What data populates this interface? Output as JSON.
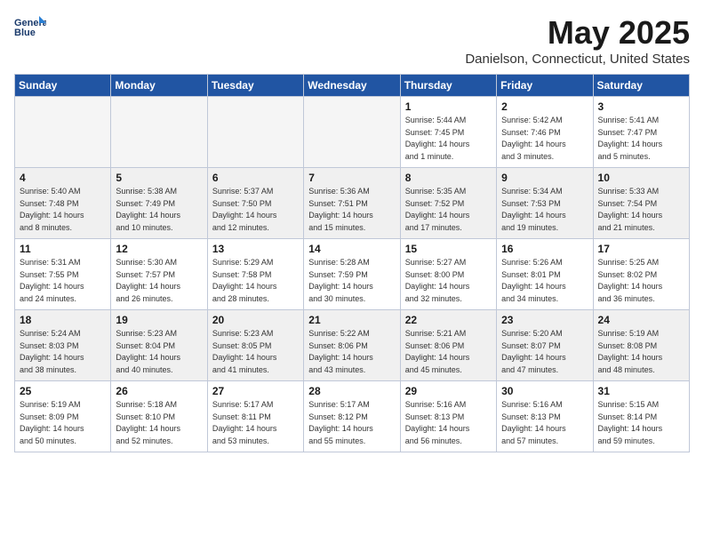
{
  "logo": {
    "line1": "General",
    "line2": "Blue"
  },
  "title": "May 2025",
  "subtitle": "Danielson, Connecticut, United States",
  "days_of_week": [
    "Sunday",
    "Monday",
    "Tuesday",
    "Wednesday",
    "Thursday",
    "Friday",
    "Saturday"
  ],
  "weeks": [
    [
      {
        "day": "",
        "info": "",
        "empty": true
      },
      {
        "day": "",
        "info": "",
        "empty": true
      },
      {
        "day": "",
        "info": "",
        "empty": true
      },
      {
        "day": "",
        "info": "",
        "empty": true
      },
      {
        "day": "1",
        "info": "Sunrise: 5:44 AM\nSunset: 7:45 PM\nDaylight: 14 hours\nand 1 minute."
      },
      {
        "day": "2",
        "info": "Sunrise: 5:42 AM\nSunset: 7:46 PM\nDaylight: 14 hours\nand 3 minutes."
      },
      {
        "day": "3",
        "info": "Sunrise: 5:41 AM\nSunset: 7:47 PM\nDaylight: 14 hours\nand 5 minutes."
      }
    ],
    [
      {
        "day": "4",
        "info": "Sunrise: 5:40 AM\nSunset: 7:48 PM\nDaylight: 14 hours\nand 8 minutes.",
        "shaded": true
      },
      {
        "day": "5",
        "info": "Sunrise: 5:38 AM\nSunset: 7:49 PM\nDaylight: 14 hours\nand 10 minutes.",
        "shaded": true
      },
      {
        "day": "6",
        "info": "Sunrise: 5:37 AM\nSunset: 7:50 PM\nDaylight: 14 hours\nand 12 minutes.",
        "shaded": true
      },
      {
        "day": "7",
        "info": "Sunrise: 5:36 AM\nSunset: 7:51 PM\nDaylight: 14 hours\nand 15 minutes.",
        "shaded": true
      },
      {
        "day": "8",
        "info": "Sunrise: 5:35 AM\nSunset: 7:52 PM\nDaylight: 14 hours\nand 17 minutes.",
        "shaded": true
      },
      {
        "day": "9",
        "info": "Sunrise: 5:34 AM\nSunset: 7:53 PM\nDaylight: 14 hours\nand 19 minutes.",
        "shaded": true
      },
      {
        "day": "10",
        "info": "Sunrise: 5:33 AM\nSunset: 7:54 PM\nDaylight: 14 hours\nand 21 minutes.",
        "shaded": true
      }
    ],
    [
      {
        "day": "11",
        "info": "Sunrise: 5:31 AM\nSunset: 7:55 PM\nDaylight: 14 hours\nand 24 minutes."
      },
      {
        "day": "12",
        "info": "Sunrise: 5:30 AM\nSunset: 7:57 PM\nDaylight: 14 hours\nand 26 minutes."
      },
      {
        "day": "13",
        "info": "Sunrise: 5:29 AM\nSunset: 7:58 PM\nDaylight: 14 hours\nand 28 minutes."
      },
      {
        "day": "14",
        "info": "Sunrise: 5:28 AM\nSunset: 7:59 PM\nDaylight: 14 hours\nand 30 minutes."
      },
      {
        "day": "15",
        "info": "Sunrise: 5:27 AM\nSunset: 8:00 PM\nDaylight: 14 hours\nand 32 minutes."
      },
      {
        "day": "16",
        "info": "Sunrise: 5:26 AM\nSunset: 8:01 PM\nDaylight: 14 hours\nand 34 minutes."
      },
      {
        "day": "17",
        "info": "Sunrise: 5:25 AM\nSunset: 8:02 PM\nDaylight: 14 hours\nand 36 minutes."
      }
    ],
    [
      {
        "day": "18",
        "info": "Sunrise: 5:24 AM\nSunset: 8:03 PM\nDaylight: 14 hours\nand 38 minutes.",
        "shaded": true
      },
      {
        "day": "19",
        "info": "Sunrise: 5:23 AM\nSunset: 8:04 PM\nDaylight: 14 hours\nand 40 minutes.",
        "shaded": true
      },
      {
        "day": "20",
        "info": "Sunrise: 5:23 AM\nSunset: 8:05 PM\nDaylight: 14 hours\nand 41 minutes.",
        "shaded": true
      },
      {
        "day": "21",
        "info": "Sunrise: 5:22 AM\nSunset: 8:06 PM\nDaylight: 14 hours\nand 43 minutes.",
        "shaded": true
      },
      {
        "day": "22",
        "info": "Sunrise: 5:21 AM\nSunset: 8:06 PM\nDaylight: 14 hours\nand 45 minutes.",
        "shaded": true
      },
      {
        "day": "23",
        "info": "Sunrise: 5:20 AM\nSunset: 8:07 PM\nDaylight: 14 hours\nand 47 minutes.",
        "shaded": true
      },
      {
        "day": "24",
        "info": "Sunrise: 5:19 AM\nSunset: 8:08 PM\nDaylight: 14 hours\nand 48 minutes.",
        "shaded": true
      }
    ],
    [
      {
        "day": "25",
        "info": "Sunrise: 5:19 AM\nSunset: 8:09 PM\nDaylight: 14 hours\nand 50 minutes."
      },
      {
        "day": "26",
        "info": "Sunrise: 5:18 AM\nSunset: 8:10 PM\nDaylight: 14 hours\nand 52 minutes."
      },
      {
        "day": "27",
        "info": "Sunrise: 5:17 AM\nSunset: 8:11 PM\nDaylight: 14 hours\nand 53 minutes."
      },
      {
        "day": "28",
        "info": "Sunrise: 5:17 AM\nSunset: 8:12 PM\nDaylight: 14 hours\nand 55 minutes."
      },
      {
        "day": "29",
        "info": "Sunrise: 5:16 AM\nSunset: 8:13 PM\nDaylight: 14 hours\nand 56 minutes."
      },
      {
        "day": "30",
        "info": "Sunrise: 5:16 AM\nSunset: 8:13 PM\nDaylight: 14 hours\nand 57 minutes."
      },
      {
        "day": "31",
        "info": "Sunrise: 5:15 AM\nSunset: 8:14 PM\nDaylight: 14 hours\nand 59 minutes."
      }
    ]
  ]
}
